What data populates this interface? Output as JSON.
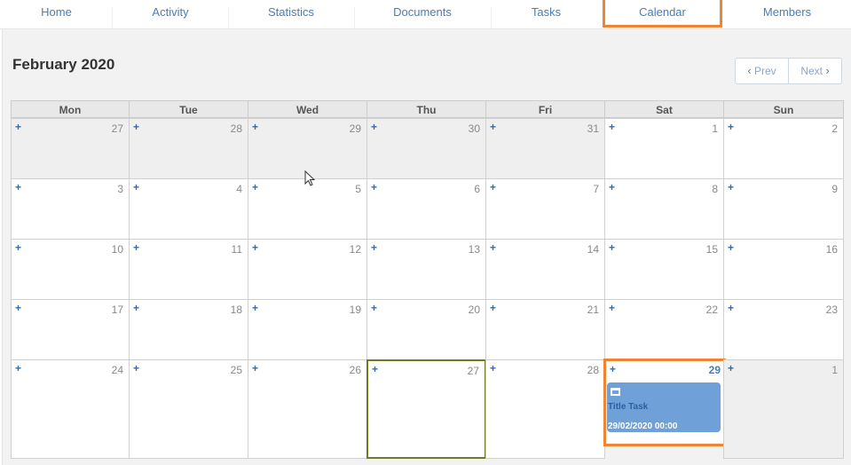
{
  "nav": {
    "tabs": [
      {
        "label": "Home",
        "active": false
      },
      {
        "label": "Activity",
        "active": false
      },
      {
        "label": "Statistics",
        "active": false
      },
      {
        "label": "Documents",
        "active": false
      },
      {
        "label": "Tasks",
        "active": false
      },
      {
        "label": "Calendar",
        "active": true
      },
      {
        "label": "Members",
        "active": false
      }
    ]
  },
  "calendar": {
    "title": "February 2020",
    "prev_label": "Prev",
    "next_label": "Next",
    "weekdays": [
      "Mon",
      "Tue",
      "Wed",
      "Thu",
      "Fri",
      "Sat",
      "Sun"
    ],
    "add_symbol": "+",
    "weeks": [
      [
        {
          "d": "27",
          "other": true
        },
        {
          "d": "28",
          "other": true
        },
        {
          "d": "29",
          "other": true
        },
        {
          "d": "30",
          "other": true
        },
        {
          "d": "31",
          "other": true
        },
        {
          "d": "1"
        },
        {
          "d": "2"
        }
      ],
      [
        {
          "d": "3"
        },
        {
          "d": "4"
        },
        {
          "d": "5"
        },
        {
          "d": "6"
        },
        {
          "d": "7"
        },
        {
          "d": "8"
        },
        {
          "d": "9"
        }
      ],
      [
        {
          "d": "10"
        },
        {
          "d": "11"
        },
        {
          "d": "12"
        },
        {
          "d": "13"
        },
        {
          "d": "14"
        },
        {
          "d": "15"
        },
        {
          "d": "16"
        }
      ],
      [
        {
          "d": "17"
        },
        {
          "d": "18"
        },
        {
          "d": "19"
        },
        {
          "d": "20"
        },
        {
          "d": "21"
        },
        {
          "d": "22"
        },
        {
          "d": "23"
        }
      ],
      [
        {
          "d": "24"
        },
        {
          "d": "25"
        },
        {
          "d": "26"
        },
        {
          "d": "27",
          "today": true
        },
        {
          "d": "28"
        },
        {
          "d": "29",
          "selected": true
        },
        {
          "d": "1",
          "other": true
        }
      ]
    ],
    "event": {
      "title": "Title Task",
      "datetime": "29/02/2020 00:00",
      "icon": "window-icon"
    }
  },
  "colors": {
    "accent": "#ef8532",
    "link": "#4a7db6",
    "event_bg": "#6fa0d8",
    "today_border": "#707820"
  }
}
